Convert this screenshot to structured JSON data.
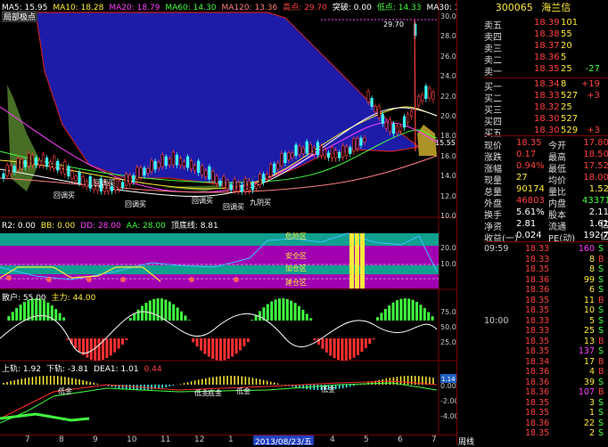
{
  "main_pane": {
    "ma_legend": [
      {
        "label": "MA5: 15.95",
        "color": "#ffffff"
      },
      {
        "label": "MA10: 18.28",
        "color": "#ffeb3b"
      },
      {
        "label": "MA20: 18.79",
        "color": "#ff40ff"
      },
      {
        "label": "MA60: 14.30",
        "color": "#40ff40"
      },
      {
        "label": "MA120: 13.36",
        "color": "#ff8080"
      },
      {
        "label": "高点: 29.70",
        "color": "#ff4040"
      },
      {
        "label": "突破: 0.00",
        "color": "#ffffff"
      },
      {
        "label": "低点: 14.33",
        "color": "#40ff40"
      },
      {
        "label": "MA30: 17.7",
        "color": "#ffffff"
      }
    ],
    "subtitle": "局部极点",
    "price_axis": [
      "30.00",
      "28.00",
      "26.00",
      "24.00",
      "22.00",
      "20.00",
      "18.00",
      "16.00",
      "14.00",
      "12.00",
      "10.00"
    ],
    "high_marker": "29.70",
    "low_marker": "15.55",
    "annotations": [
      "回调买",
      "回调买",
      "回调买",
      "回调买",
      "回调买",
      "九阴买"
    ]
  },
  "pane2": {
    "legend": [
      {
        "label": "R2: 0.00",
        "color": "#ffffff"
      },
      {
        "label": "BB: 0.00",
        "color": "#ffeb3b"
      },
      {
        "label": "DD: 28.00",
        "color": "#ff40ff"
      },
      {
        "label": "AA: 28.00",
        "color": "#40ff40"
      },
      {
        "label": "顶底线: 8.81",
        "color": "#ffffff"
      }
    ],
    "zones": [
      "危险区",
      "安全区",
      "加仓区",
      "建仓区"
    ],
    "axis": [
      "20.00",
      "10.00"
    ]
  },
  "pane3": {
    "legend": [
      {
        "label": "散户: 55.00",
        "color": "#ffffff"
      },
      {
        "label": "主力: 44.00",
        "color": "#ffeb3b"
      }
    ],
    "axis": [
      "75.00",
      "50.00",
      "25.00"
    ]
  },
  "pane4": {
    "legend": [
      {
        "label": "上轨: 1.92",
        "color": "#ffffff"
      },
      {
        "label": "下轨: -3.81",
        "color": "#ffffff"
      },
      {
        "label": "DEA1: 1.01",
        "color": "#ffffff"
      },
      {
        "label": "0.44",
        "color": "#ff4040"
      }
    ],
    "axis": [
      "0.00",
      "-2.00",
      "-4.00"
    ],
    "badge": "1.14",
    "annotations": [
      "低金",
      "低金",
      "底金",
      "低金",
      "低金"
    ]
  },
  "x_axis": {
    "ticks": [
      "7",
      "8",
      "9",
      "10",
      "11",
      "12",
      "1",
      "2",
      "3",
      "4",
      "5",
      "6",
      "7"
    ],
    "highlight": "2013/08/23/五",
    "period": "周线"
  },
  "quote": {
    "code": "300065",
    "name": "海兰信",
    "sell": [
      {
        "label": "卖五",
        "price": "18.39",
        "vol": "101",
        "chg": ""
      },
      {
        "label": "卖四",
        "price": "18.38",
        "vol": "55",
        "chg": ""
      },
      {
        "label": "卖三",
        "price": "18.37",
        "vol": "20",
        "chg": ""
      },
      {
        "label": "卖二",
        "price": "18.36",
        "vol": "5",
        "chg": ""
      },
      {
        "label": "卖一",
        "price": "18.35",
        "vol": "25",
        "chg": "-27"
      }
    ],
    "buy": [
      {
        "label": "买一",
        "price": "18.34",
        "vol": "8",
        "chg": "+19"
      },
      {
        "label": "买二",
        "price": "18.33",
        "vol": "527",
        "chg": "+3"
      },
      {
        "label": "买三",
        "price": "18.32",
        "vol": "25",
        "chg": ""
      },
      {
        "label": "买四",
        "price": "18.30",
        "vol": "527",
        "chg": ""
      },
      {
        "label": "买五",
        "price": "18.30",
        "vol": "529",
        "chg": "+3"
      }
    ],
    "stats": [
      {
        "l1": "现价",
        "v1": "18.35",
        "l2": "今开",
        "v2": "17.80"
      },
      {
        "l1": "涨跌",
        "v1": "0.17",
        "l2": "最高",
        "v2": "18.50"
      },
      {
        "l1": "涨幅",
        "v1": "0.94%",
        "l2": "最低",
        "v2": "17.52"
      },
      {
        "l1": "现量",
        "v1": "27",
        "l2": "均价",
        "v2": "18.00"
      },
      {
        "l1": "总量",
        "v1": "90174",
        "l2": "量比",
        "v2": "1.52"
      },
      {
        "l1": "外盘",
        "v1": "46803",
        "l2": "内盘",
        "v2": "43371"
      },
      {
        "l1": "换手",
        "v1": "5.61%",
        "l2": "股本",
        "v2": "2.11亿"
      },
      {
        "l1": "净资",
        "v1": "2.81",
        "l2": "流通",
        "v2": "1.61亿"
      },
      {
        "l1": "收益(一)",
        "v1": "0.024",
        "l2": "PE(动)",
        "v2": "192.7"
      }
    ],
    "ticks": [
      {
        "time": "09:59",
        "price": "18.33",
        "vol": "160",
        "dir": "S"
      },
      {
        "time": "",
        "price": "18.33",
        "vol": "8",
        "dir": "B"
      },
      {
        "time": "",
        "price": "18.35",
        "vol": "8",
        "dir": "S"
      },
      {
        "time": "",
        "price": "18.36",
        "vol": "99",
        "dir": "S"
      },
      {
        "time": "",
        "price": "18.36",
        "vol": "6",
        "dir": "S"
      },
      {
        "time": "",
        "price": "18.35",
        "vol": "11",
        "dir": "B"
      },
      {
        "time": "",
        "price": "18.35",
        "vol": "10",
        "dir": "S"
      },
      {
        "time": "10:00",
        "price": "18.33",
        "vol": "5",
        "dir": "S"
      },
      {
        "time": "",
        "price": "18.33",
        "vol": "25",
        "dir": "S"
      },
      {
        "time": "",
        "price": "18.35",
        "vol": "13",
        "dir": "B"
      },
      {
        "time": "",
        "price": "18.35",
        "vol": "137",
        "dir": "S"
      },
      {
        "time": "",
        "price": "18.34",
        "vol": "17",
        "dir": "B"
      },
      {
        "time": "",
        "price": "18.36",
        "vol": "4",
        "dir": "B"
      },
      {
        "time": "",
        "price": "18.36",
        "vol": "39",
        "dir": "S"
      },
      {
        "time": "",
        "price": "18.36",
        "vol": "107",
        "dir": "B"
      },
      {
        "time": "",
        "price": "18.35",
        "vol": "3",
        "dir": "S"
      },
      {
        "time": "",
        "price": "18.35",
        "vol": "1",
        "dir": "S"
      },
      {
        "time": "",
        "price": "18.36",
        "vol": "22",
        "dir": "S"
      },
      {
        "time": "",
        "price": "18.35",
        "vol": "2",
        "dir": "S"
      }
    ]
  },
  "colors": {
    "up": "#ff4040",
    "down": "#40ffff",
    "cloud": "#1c1ca8",
    "magenta": "#a000b0",
    "teal": "#10a090",
    "yellow": "#ffeb3b"
  }
}
